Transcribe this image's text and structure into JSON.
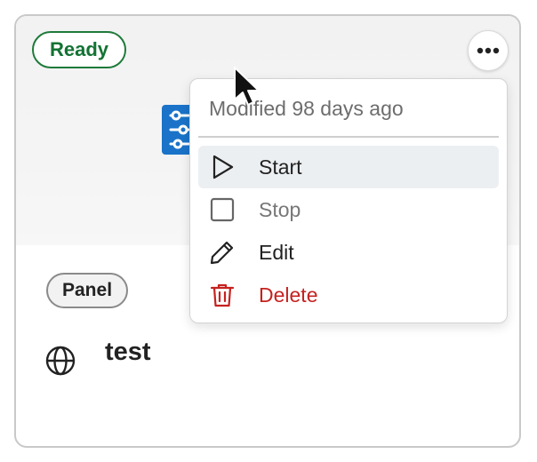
{
  "card": {
    "status": "Ready",
    "type_label": "Panel",
    "title": "test",
    "more_icon": "more-horizontal-icon",
    "app_icon": "sliders-icon",
    "scope_icon": "globe-icon"
  },
  "menu": {
    "meta": "Modified 98 days ago",
    "items": [
      {
        "label": "Start",
        "icon": "play-icon",
        "state": "highlighted"
      },
      {
        "label": "Stop",
        "icon": "stop-icon",
        "state": "disabled"
      },
      {
        "label": "Edit",
        "icon": "pencil-icon",
        "state": "normal"
      },
      {
        "label": "Delete",
        "icon": "trash-icon",
        "state": "danger"
      }
    ]
  },
  "colors": {
    "ready_green": "#137333",
    "delete_red": "#c5221f",
    "app_icon_blue": "#1a73c8",
    "highlight_bg": "#eceff2"
  }
}
